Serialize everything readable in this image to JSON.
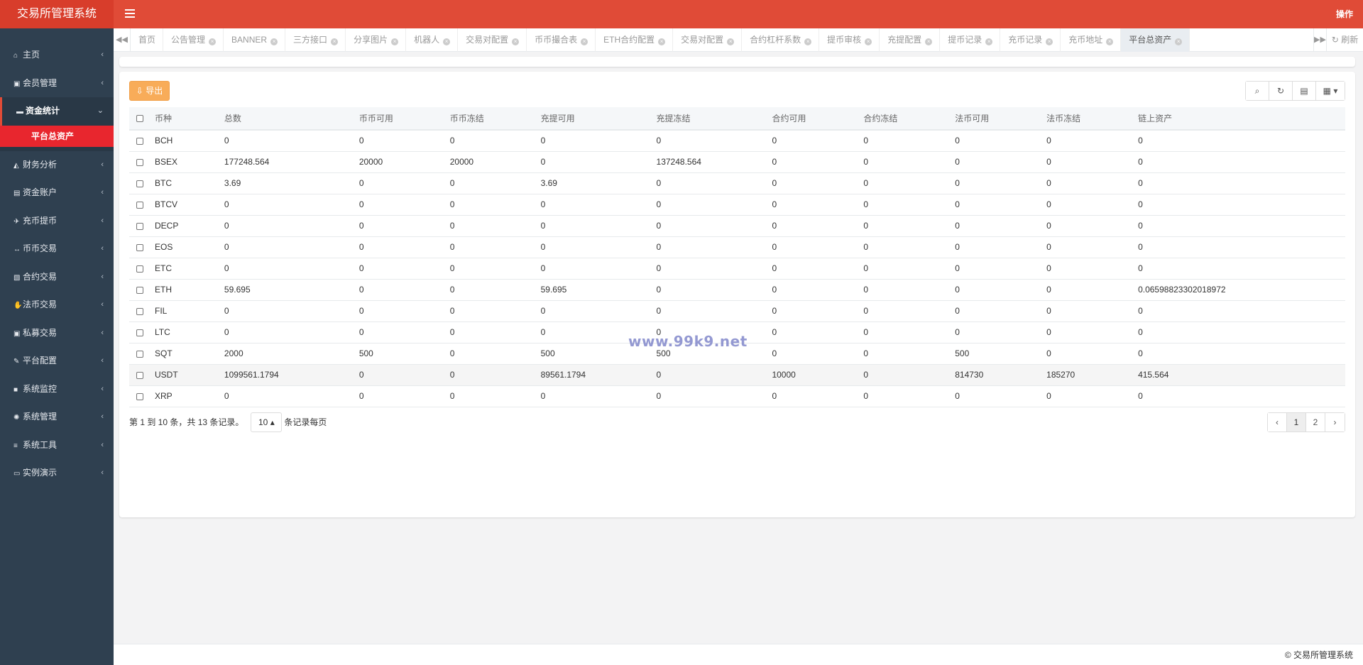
{
  "app": {
    "title": "交易所管理系统",
    "action_label": "操作"
  },
  "sidebar": {
    "items": [
      {
        "label": "主页",
        "icon": "home-icon",
        "glyph": "⌂"
      },
      {
        "label": "会员管理",
        "icon": "user-card-icon",
        "glyph": "▣"
      },
      {
        "label": "资金统计",
        "icon": "battery-icon",
        "glyph": "▬",
        "active": true,
        "children": [
          {
            "label": "平台总资产"
          }
        ]
      },
      {
        "label": "财务分析",
        "icon": "area-chart-icon",
        "glyph": "◭"
      },
      {
        "label": "资金账户",
        "icon": "calculator-icon",
        "glyph": "▤"
      },
      {
        "label": "充币提币",
        "icon": "plane-icon",
        "glyph": "✈"
      },
      {
        "label": "币币交易",
        "icon": "arrows-h-icon",
        "glyph": "↔"
      },
      {
        "label": "合约交易",
        "icon": "book-icon",
        "glyph": "▧"
      },
      {
        "label": "法币交易",
        "icon": "handshake-icon",
        "glyph": "✋"
      },
      {
        "label": "私募交易",
        "icon": "address-card-icon",
        "glyph": "▣"
      },
      {
        "label": "平台配置",
        "icon": "magic-icon",
        "glyph": "✎"
      },
      {
        "label": "系统监控",
        "icon": "video-camera-icon",
        "glyph": "■"
      },
      {
        "label": "系统管理",
        "icon": "gear-icon",
        "glyph": "✺"
      },
      {
        "label": "系统工具",
        "icon": "bars-icon",
        "glyph": "≡"
      },
      {
        "label": "实例演示",
        "icon": "desktop-icon",
        "glyph": "▭"
      }
    ]
  },
  "tabs": [
    {
      "label": "首页",
      "closable": false
    },
    {
      "label": "公告管理",
      "closable": true
    },
    {
      "label": "BANNER",
      "closable": true
    },
    {
      "label": "三方接口",
      "closable": true
    },
    {
      "label": "分享图片",
      "closable": true
    },
    {
      "label": "机器人",
      "closable": true
    },
    {
      "label": "交易对配置",
      "closable": true
    },
    {
      "label": "币币撮合表",
      "closable": true
    },
    {
      "label": "ETH合约配置",
      "closable": true
    },
    {
      "label": "交易对配置",
      "closable": true
    },
    {
      "label": "合约杠杆系数",
      "closable": true
    },
    {
      "label": "提币审核",
      "closable": true
    },
    {
      "label": "充提配置",
      "closable": true
    },
    {
      "label": "提币记录",
      "closable": true
    },
    {
      "label": "充币记录",
      "closable": true
    },
    {
      "label": "充币地址",
      "closable": true
    },
    {
      "label": "平台总资产",
      "closable": true,
      "active": true
    }
  ],
  "tabs_refresh_label": "刷新",
  "toolbar": {
    "export_label": "导出"
  },
  "table": {
    "columns": [
      "币种",
      "总数",
      "币币可用",
      "币币冻结",
      "充提可用",
      "充提冻结",
      "合约可用",
      "合约冻结",
      "法币可用",
      "法币冻结",
      "链上资产"
    ],
    "rows": [
      [
        "BCH",
        "0",
        "0",
        "0",
        "0",
        "0",
        "0",
        "0",
        "0",
        "0",
        "0"
      ],
      [
        "BSEX",
        "177248.564",
        "20000",
        "20000",
        "0",
        "137248.564",
        "0",
        "0",
        "0",
        "0",
        "0"
      ],
      [
        "BTC",
        "3.69",
        "0",
        "0",
        "3.69",
        "0",
        "0",
        "0",
        "0",
        "0",
        "0"
      ],
      [
        "BTCV",
        "0",
        "0",
        "0",
        "0",
        "0",
        "0",
        "0",
        "0",
        "0",
        "0"
      ],
      [
        "DECP",
        "0",
        "0",
        "0",
        "0",
        "0",
        "0",
        "0",
        "0",
        "0",
        "0"
      ],
      [
        "EOS",
        "0",
        "0",
        "0",
        "0",
        "0",
        "0",
        "0",
        "0",
        "0",
        "0"
      ],
      [
        "ETC",
        "0",
        "0",
        "0",
        "0",
        "0",
        "0",
        "0",
        "0",
        "0",
        "0"
      ],
      [
        "ETH",
        "59.695",
        "0",
        "0",
        "59.695",
        "0",
        "0",
        "0",
        "0",
        "0",
        "0.06598823302018972"
      ],
      [
        "FIL",
        "0",
        "0",
        "0",
        "0",
        "0",
        "0",
        "0",
        "0",
        "0",
        "0"
      ],
      [
        "LTC",
        "0",
        "0",
        "0",
        "0",
        "0",
        "0",
        "0",
        "0",
        "0",
        "0"
      ],
      [
        "SQT",
        "2000",
        "500",
        "0",
        "500",
        "500",
        "0",
        "0",
        "500",
        "0",
        "0"
      ],
      [
        "USDT",
        "1099561.1794",
        "0",
        "0",
        "89561.1794",
        "0",
        "10000",
        "0",
        "814730",
        "185270",
        "415.564"
      ],
      [
        "XRP",
        "0",
        "0",
        "0",
        "0",
        "0",
        "0",
        "0",
        "0",
        "0",
        "0"
      ]
    ],
    "highlight_row": 11
  },
  "pager": {
    "info": "第 1 到 10 条，共 13 条记录。",
    "page_size": "10",
    "per_page_label": "条记录每页",
    "pages": [
      "‹",
      "1",
      "2",
      "›"
    ],
    "current": "1"
  },
  "watermark": "www.99k9.net",
  "footer": "© 交易所管理系统"
}
